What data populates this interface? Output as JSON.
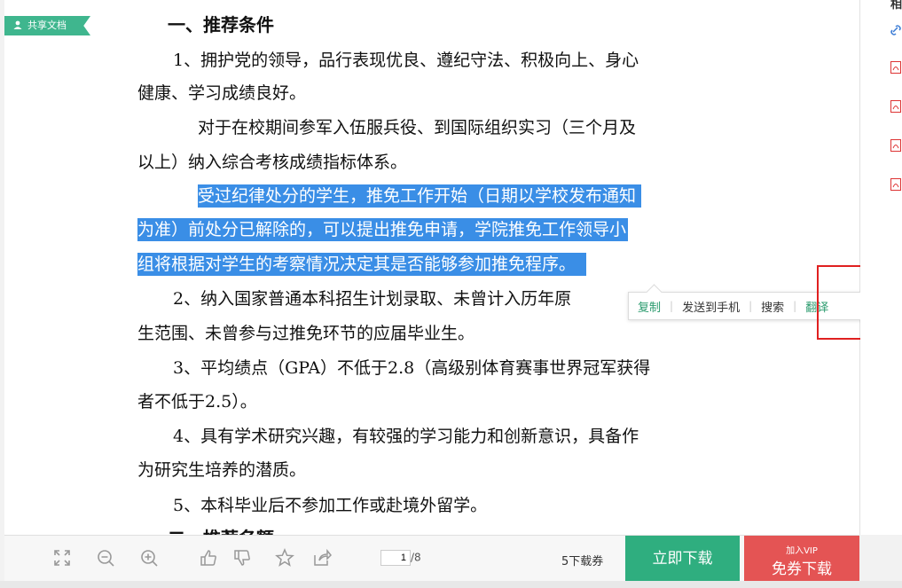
{
  "badge": {
    "label": "共享文档"
  },
  "document": {
    "heading": "一、推荐条件",
    "lines": [
      {
        "text": "1、拥护党的领导，品行表现优良、遵纪守法、积极向上、身心"
      },
      {
        "text": "健康、学习成绩良好。"
      },
      {
        "text": "对于在校期间参军入伍服兵役、到国际组织实习（三个月及"
      },
      {
        "text": "以上）纳入综合考核成绩指标体系。"
      },
      {
        "text": "受过纪律处分的学生，推免工作开始（日期以学校发布通知"
      },
      {
        "text": "为准）前处分已解除的，可以提出推免申请，学院推免工作领导小"
      },
      {
        "text": "组将根据对学生的考察情况决定其是否能够参加推免程序。"
      },
      {
        "text": "2、纳入国家普通本科招生计划录取、未曾计入历年原"
      },
      {
        "text": "生范围、未曾参与过推免环节的应届毕业生。"
      },
      {
        "text": "3、平均绩点（GPA）不低于2.8（高级别体育赛事世界冠军获得"
      },
      {
        "text": "者不低于2.5）。"
      },
      {
        "text": "4、具有学术研究兴趣，有较强的学习能力和创新意识，具备作"
      },
      {
        "text": "为研究生培养的潜质。"
      },
      {
        "text": "5、本科毕业后不参加工作或赴境外留学。"
      },
      {
        "text": "二、推荐名额"
      }
    ]
  },
  "popup": {
    "copy": "复制",
    "send": "发送到手机",
    "search": "搜索",
    "translate": "翻译"
  },
  "right_panel": {
    "title": "相"
  },
  "toolbar": {
    "page_current": "1",
    "page_total": "/8",
    "coupons": "5下载券",
    "download": "立即下载",
    "vip_small": "加入VIP",
    "vip_big": "免券下载"
  },
  "colors": {
    "highlight": "#3a8ee6",
    "green": "#2fae7f",
    "red": "#e45454",
    "badge": "#3fb68e"
  }
}
